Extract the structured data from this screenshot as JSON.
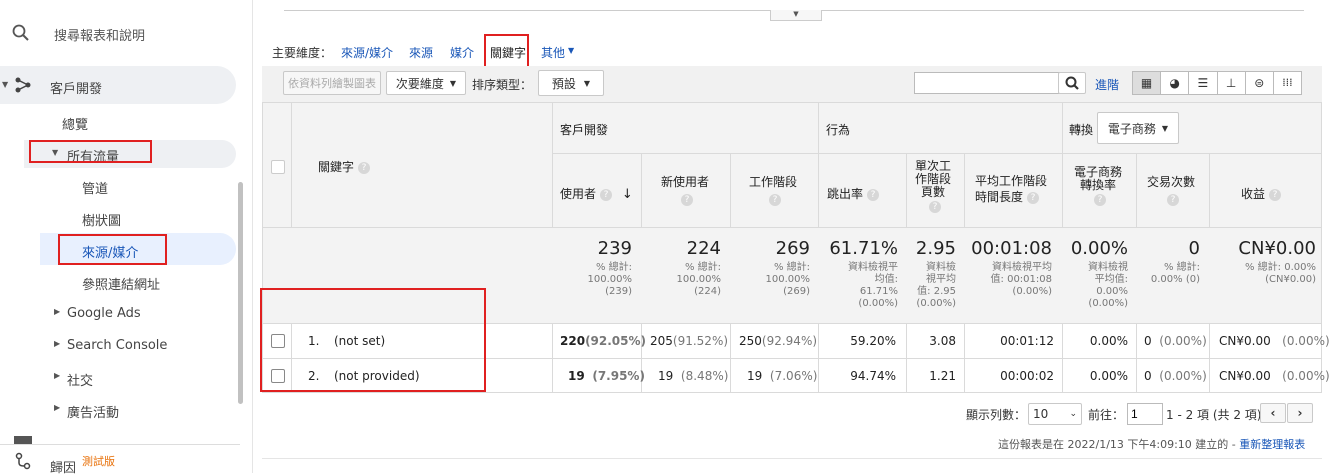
{
  "sidebar": {
    "search_label": "搜尋報表和說明",
    "acquisition": "客戶開發",
    "overview": "總覽",
    "all_traffic": "所有流量",
    "channels": "管道",
    "treemap": "樹狀圖",
    "source_medium": "來源/媒介",
    "referrals": "參照連結網址",
    "google_ads": "Google Ads",
    "search_console": "Search Console",
    "social": "社交",
    "campaigns": "廣告活動",
    "attribution": "歸因",
    "beta": "測試版"
  },
  "dimensions": {
    "label": "主要維度：",
    "items": [
      "來源/媒介",
      "來源",
      "媒介",
      "關鍵字",
      "其他"
    ]
  },
  "toolbar": {
    "plot_rows": "依資料列繪製圖表",
    "secondary_dim": "次要維度",
    "sort_label": "排序類型：",
    "sort_value": "預設",
    "advanced": "進階",
    "search_placeholder": ""
  },
  "table": {
    "group_acquisition": "客戶開發",
    "group_behavior": "行為",
    "group_conversion": "轉換",
    "conversion_select": "電子商務",
    "keyword_header": "關鍵字",
    "columns": [
      "使用者",
      "新使用者",
      "工作階段",
      "跳出率",
      "單次工作階段頁數",
      "平均工作階段時間長度",
      "電子商務轉換率",
      "交易次數",
      "收益"
    ],
    "col_lines": {
      "pages_per_session": [
        "單次工",
        "作階段",
        "頁數"
      ],
      "avg_duration": [
        "平均工作階段",
        "時間長度"
      ],
      "ecom_rate": [
        "電子商務",
        "轉換率"
      ]
    },
    "totals": {
      "users": "239",
      "users_sub": [
        "% 總計:",
        "100.00%",
        "(239)"
      ],
      "new_users": "224",
      "new_users_sub": [
        "% 總計:",
        "100.00%",
        "(224)"
      ],
      "sessions": "269",
      "sessions_sub": [
        "% 總計:",
        "100.00%",
        "(269)"
      ],
      "bounce": "61.71%",
      "bounce_sub": [
        "資料檢視平",
        "均值:",
        "61.71%",
        "(0.00%)"
      ],
      "pages": "2.95",
      "pages_sub": [
        "資料檢",
        "視平均",
        "值: 2.95",
        "(0.00%)"
      ],
      "duration": "00:01:08",
      "duration_sub": [
        "資料檢視平均",
        "值: 00:01:08",
        "(0.00%)"
      ],
      "ecom": "0.00%",
      "ecom_sub": [
        "資料檢視",
        "平均值:",
        "0.00%",
        "(0.00%)"
      ],
      "transactions": "0",
      "transactions_sub": [
        "% 總計:",
        "0.00% (0)"
      ],
      "revenue": "CN¥0.00",
      "revenue_sub": [
        "% 總計: 0.00%",
        "(CN¥0.00)"
      ]
    },
    "rows": [
      {
        "index": "1.",
        "keyword": "(not set)",
        "users": "220",
        "users_pct": "(92.05%)",
        "new_users": "205",
        "new_users_pct": "(91.52%)",
        "sessions": "250",
        "sessions_pct": "(92.94%)",
        "bounce": "59.20%",
        "pages": "3.08",
        "duration": "00:01:12",
        "ecom": "0.00%",
        "transactions": "0",
        "transactions_pct": "(0.00%)",
        "revenue": "CN¥0.00",
        "revenue_pct": "(0.00%)"
      },
      {
        "index": "2.",
        "keyword": "(not provided)",
        "users": "19",
        "users_pct": "(7.95%)",
        "new_users": "19",
        "new_users_pct": "(8.48%)",
        "sessions": "19",
        "sessions_pct": "(7.06%)",
        "bounce": "94.74%",
        "pages": "1.21",
        "duration": "00:00:02",
        "ecom": "0.00%",
        "transactions": "0",
        "transactions_pct": "(0.00%)",
        "revenue": "CN¥0.00",
        "revenue_pct": "(0.00%)"
      }
    ]
  },
  "pagination": {
    "rows_label": "顯示列數：",
    "rows_value": "10",
    "goto_label": "前往：",
    "goto_value": "1",
    "range": "1 - 2 項 (共 2 項)"
  },
  "footer": {
    "generated": "這份報表是在 2022/1/13 下午4:09:10 建立的 - ",
    "refresh": "重新整理報表"
  },
  "colors": {
    "accent_red": "#e02020",
    "link_blue": "#1a57b8"
  }
}
